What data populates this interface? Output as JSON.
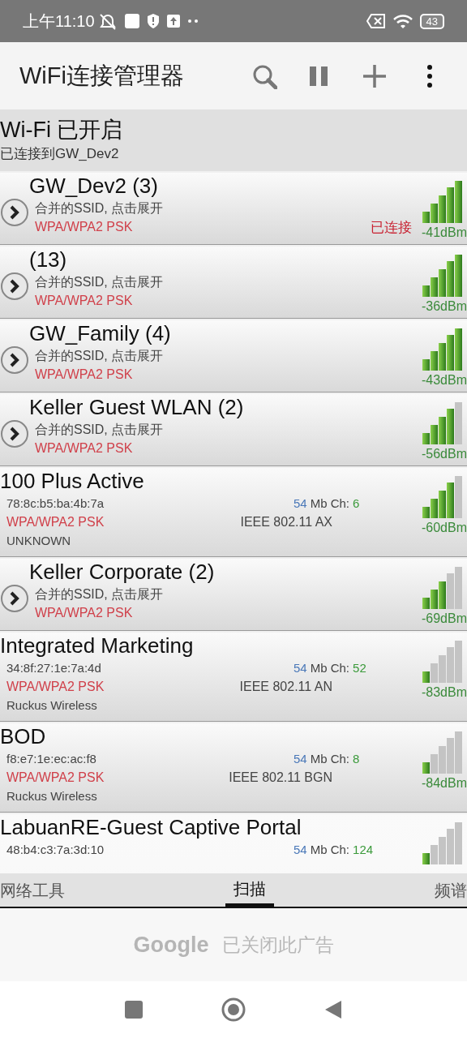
{
  "status_bar": {
    "time": "上午11:10",
    "battery": "43"
  },
  "app_bar": {
    "title": "WiFi连接管理器"
  },
  "wifi_status": {
    "title": "Wi-Fi 已开启",
    "subtitle": "已连接到GW_Dev2"
  },
  "networks": [
    {
      "kind": "group",
      "name": "GW_Dev2 (3)",
      "subtitle": "合并的SSID, 点击展开",
      "security": "WPA/WPA2 PSK",
      "connected_label": "已连接",
      "reading": "-41dBm"
    },
    {
      "kind": "group",
      "name": "(13)",
      "subtitle": "合并的SSID, 点击展开",
      "security": "WPA/WPA2 PSK",
      "reading": "-36dBm"
    },
    {
      "kind": "group",
      "name": "GW_Family (4)",
      "subtitle": "合并的SSID, 点击展开",
      "security": "WPA/WPA2 PSK",
      "reading": "-43dBm"
    },
    {
      "kind": "group",
      "name": "Keller Guest WLAN (2)",
      "subtitle": "合并的SSID, 点击展开",
      "security": "WPA/WPA2 PSK",
      "reading": "-56dBm"
    },
    {
      "kind": "single",
      "name": "100 Plus Active",
      "mac": "78:8c:b5:ba:4b:7a",
      "rate": "54",
      "rate_label": "Mb Ch:",
      "channel": "6",
      "security": "WPA/WPA2 PSK",
      "standard": "IEEE 802.11 AX",
      "vendor": "UNKNOWN",
      "reading": "-60dBm"
    },
    {
      "kind": "group",
      "name": "Keller Corporate (2)",
      "subtitle": "合并的SSID, 点击展开",
      "security": "WPA/WPA2 PSK",
      "reading": "-69dBm"
    },
    {
      "kind": "single",
      "name": "Integrated Marketing",
      "mac": "34:8f:27:1e:7a:4d",
      "rate": "54",
      "rate_label": "Mb Ch:",
      "channel": "52",
      "security": "WPA/WPA2 PSK",
      "standard": "IEEE 802.11 AN",
      "vendor": "Ruckus Wireless",
      "reading": "-83dBm"
    },
    {
      "kind": "single",
      "name": "BOD",
      "mac": "f8:e7:1e:ec:ac:f8",
      "rate": "54",
      "rate_label": "Mb Ch:",
      "channel": "8",
      "security": "WPA/WPA2 PSK",
      "standard": "IEEE 802.11 BGN",
      "vendor": "Ruckus Wireless",
      "reading": "-84dBm"
    },
    {
      "kind": "single",
      "name": "LabuanRE-Guest Captive Portal",
      "mac": "48:b4:c3:7a:3d:10",
      "rate": "54",
      "rate_label": "Mb Ch:",
      "channel": "124"
    }
  ],
  "tabs": [
    {
      "label": "网络工具",
      "selected": false
    },
    {
      "label": "扫描",
      "selected": true
    },
    {
      "label": "频谱",
      "selected": false
    }
  ],
  "ad": {
    "brand": "Google",
    "message": "已关闭此广告"
  }
}
